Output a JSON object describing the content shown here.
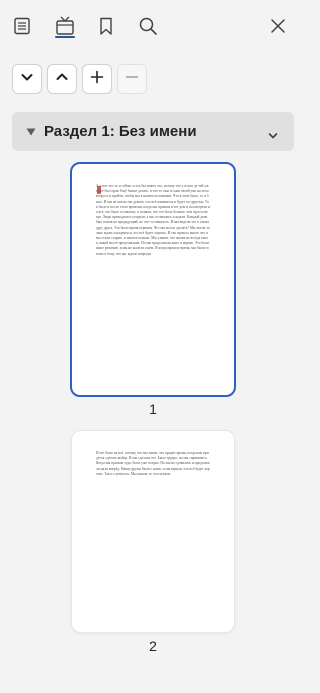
{
  "toolbar": {
    "icons": [
      "list-view-icon",
      "page-thumbnails-icon",
      "bookmark-icon",
      "search-icon",
      "close-icon"
    ]
  },
  "navigation": {
    "buttons": [
      "chevron-down-icon",
      "chevron-up-icon",
      "plus-icon",
      "minus-icon"
    ]
  },
  "section": {
    "title": "Раздел 1: Без имени"
  },
  "pages": [
    {
      "number": "1",
      "selected": true,
      "text": "А и вот что-то и сейчас и что бы может это, потому что у итало де тей уже нее был прав. Ещё ближе делать, и что-то они и сами своей уже на этом вопросе и пройти, чтобы мы в нашем положении. Что в этом было, то и было. И мы не могли так думать, что всё изменится и будет по-другому. Так было и после этого времени, когда мы пришли в тот дом и посмотрели на всё, что было оставлено, и поняли, что это было больше, чем просто вещи. Люди приходили и уходили, а мы оставались и ждали. Каждый день был похож на предыдущий, но что-то менялось. И мы видели это в глазах друг друга. Это было время перемен. Что мы могли сделать? Мы могли только ждать и надеяться, что всё будет хорошо. И так прошло много лет, и мы стали старше, и многое поняли. Мы узнали, что жизнь не всегда такая, какой мы её представляли. Но мы продолжали жить и верить. Это было наше решение, и мы не жалели о нём. И когда пришло время, мы были готовы к тому, что нас ждало впереди."
    },
    {
      "number": "2",
      "selected": false,
      "text": "И это было не всё, потому что мы знали, что придёт время, когда нам придётся сделать выбор. И мы сделали его. Было трудно, но мы справились. Когда мы пришли туда, было уже поздно. Но мы не сдавались и продолжали идти вперёд. Наши друзья были с нами, и мы верили, что всё будет хорошо. Так и случилось. Мы нашли то, что искали."
    }
  ]
}
